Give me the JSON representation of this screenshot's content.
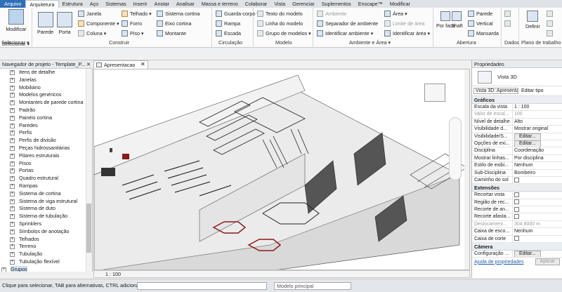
{
  "tabs": [
    "Arquivo",
    "Arquitetura",
    "Estrutura",
    "Aço",
    "Sistemas",
    "Inserir",
    "Anotar",
    "Analisar",
    "Massa e terreno",
    "Colaborar",
    "Vista",
    "Gerenciar",
    "Suplementos",
    "Enscape™",
    "Modificar"
  ],
  "ribbon": {
    "modify": {
      "label": "Modificar",
      "select": "Selecionar ▾"
    },
    "build": {
      "parede": "Parede",
      "porta": "Porta",
      "janela": "Janela",
      "componente": "Componente ▾",
      "coluna": "Coluna ▾",
      "telhado": "Telhado ▾",
      "forro": "Forro",
      "piso": "Piso ▾",
      "sistema_cortina": "Sistema cortina",
      "eixo_cortina": "Eixo cortina",
      "montante": "Montante",
      "label": "Construir"
    },
    "circulation": {
      "guarda_corpo": "Guarda-corpo ▾",
      "rampa": "Rampa",
      "escada": "Escada",
      "label": "Circulação"
    },
    "model": {
      "texto": "Texto do modelo",
      "linha": "Linha do modelo",
      "grupo": "Grupo de modelos ▾",
      "label": "Modelo"
    },
    "room": {
      "ambiente": "Ambiente",
      "separador": "Separador de ambiente",
      "identificar": "Identificar ambiente ▾",
      "area": "Área ▾",
      "limite": "Limite de área",
      "identificar_area": "Identificar área ▾",
      "label": "Ambiente e Área ▾"
    },
    "opening": {
      "por_face": "Por face",
      "shaft": "Shaft",
      "parede": "Parede",
      "vertical": "Vertical",
      "mansarda": "Mansarda",
      "label": "Abertura"
    },
    "datum": {
      "label": "Dados"
    },
    "workplane": {
      "definir": "Definir",
      "label": "Plano de trabalho"
    }
  },
  "optionsbar": {
    "c1": "Construir",
    "c2": "Circulação",
    "c3": "Modelo",
    "c4": "Ambiente e Área",
    "c5": "Abertura",
    "c6": "Dados",
    "c7": "Plano de trabalho"
  },
  "browser": {
    "title": "Navegador de projeto - Template_P...",
    "items": [
      "Itens de detalhe",
      "Janelas",
      "Mobiliário",
      "Modelos genéricos",
      "Montantes de parede cortina",
      "Padrão",
      "Painéis cortina",
      "Paredes",
      "Perfis",
      "Perfis de divisão",
      "Peças hidrossanitárias",
      "Pilares estruturais",
      "Pisos",
      "Portas",
      "Quadro estrutural",
      "Rampas",
      "Sistema de cortina",
      "Sistema de viga estrutural",
      "Sistema de duto",
      "Sistema de tubulação",
      "Sprinklers",
      "Símbolos de anotação",
      "Telhados",
      "Terreno",
      "Tubulação",
      "Tubulação flexível"
    ],
    "grupos": "Grupos"
  },
  "view": {
    "tab": "Apresentacao",
    "scale": "1 : 100"
  },
  "properties": {
    "title": "Propriedades",
    "type": "Vista 3D",
    "selector": "Vista 3D: Apresenta",
    "edit_type": "Editar tipo",
    "sections": [
      {
        "name": "Gráficos",
        "rows": [
          [
            "Escala da vista",
            "1 : 100",
            ""
          ],
          [
            "Valor de escal...",
            "100",
            "dim"
          ],
          [
            "Nível de detalhe",
            "Alto",
            ""
          ],
          [
            "Visibilidade d...",
            "Mostrar original",
            ""
          ],
          [
            "Visibilidade/S...",
            "Editar...",
            "btn"
          ],
          [
            "Opções de exi...",
            "Editar...",
            "btn"
          ],
          [
            "Disciplina",
            "Coordenação",
            ""
          ],
          [
            "Mostrar linhas...",
            "Por disciplina",
            ""
          ],
          [
            "Estilo de exibi...",
            "Nenhum",
            ""
          ],
          [
            "Sub-Disciplina",
            "Bombeiro",
            ""
          ],
          [
            "Caminho do sol",
            "",
            "cb"
          ]
        ]
      },
      {
        "name": "Extensões",
        "rows": [
          [
            "Recortar vista",
            "",
            "cb"
          ],
          [
            "Região de rec...",
            "",
            "cb"
          ],
          [
            "Recorte de an...",
            "",
            "cb"
          ],
          [
            "Recorte afasta...",
            "",
            "cb"
          ],
          [
            "Deslocament...",
            "304.8000 m",
            "dim"
          ],
          [
            "Caixa de esco...",
            "Nenhum",
            ""
          ],
          [
            "Caixa de corte",
            "",
            "cb"
          ]
        ]
      },
      {
        "name": "Câmera",
        "rows": [
          [
            "Configuração ...",
            "Editar...",
            "btn"
          ]
        ]
      }
    ],
    "help": "Ajuda de propriedades",
    "apply": "Aplicar"
  },
  "status": {
    "text": "Clique para selecionar, TAB para alternativas, CTRL adiciona,",
    "model": "Modelo principal"
  }
}
